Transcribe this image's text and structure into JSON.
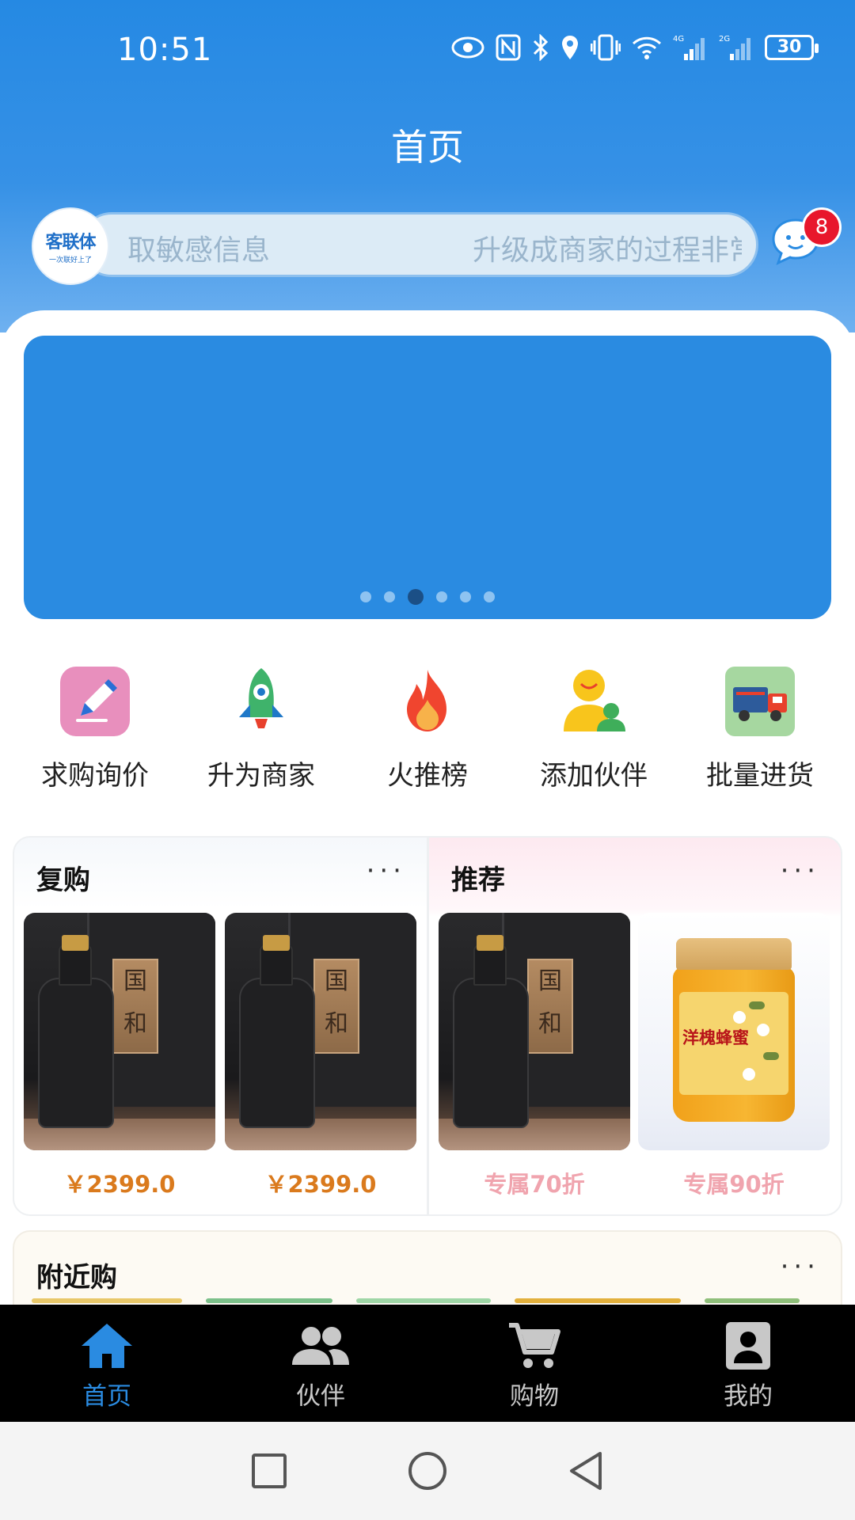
{
  "status_bar": {
    "time": "10:51",
    "battery": "30",
    "signal_labels": [
      "4G",
      "2G"
    ]
  },
  "header": {
    "title": "首页"
  },
  "search": {
    "logo_text": "客联体",
    "logo_subtext": "一次联好上了",
    "marquee_left": "取敏感信息",
    "marquee_right": "升级成商家的过程非常",
    "message_badge": "8"
  },
  "banner": {
    "dot_count": 6,
    "active_dot": 3,
    "color": "#2a8be1"
  },
  "quick_actions": [
    {
      "label": "求购询价",
      "icon": "pencil-icon"
    },
    {
      "label": "升为商家",
      "icon": "rocket-icon"
    },
    {
      "label": "火推榜",
      "icon": "fire-icon"
    },
    {
      "label": "添加伙伴",
      "icon": "add-partner-icon"
    },
    {
      "label": "批量进货",
      "icon": "truck-icon"
    }
  ],
  "repurchase": {
    "title": "复购",
    "more": "···",
    "products": [
      {
        "image": "wine-bottle-image",
        "plaque": "国和",
        "price": "￥2399.0"
      },
      {
        "image": "wine-bottle-image",
        "plaque": "国和",
        "price": "￥2399.0"
      }
    ]
  },
  "recommend": {
    "title": "推荐",
    "more": "···",
    "products": [
      {
        "image": "wine-bottle-image",
        "plaque": "国和",
        "tag": "专属70折"
      },
      {
        "image": "honey-jar-image",
        "label": "洋槐蜂蜜",
        "tag": "专属90折"
      }
    ]
  },
  "nearby": {
    "title": "附近购",
    "more": "···"
  },
  "bottom_nav": [
    {
      "label": "首页",
      "icon": "home-icon",
      "active": true
    },
    {
      "label": "伙伴",
      "icon": "partners-icon",
      "active": false
    },
    {
      "label": "购物",
      "icon": "cart-icon",
      "active": false
    },
    {
      "label": "我的",
      "icon": "profile-icon",
      "active": false
    }
  ],
  "colors": {
    "primary": "#2a8be1",
    "price": "#da7a1d",
    "discount": "#f0a4ae",
    "badge": "#e8172c"
  }
}
